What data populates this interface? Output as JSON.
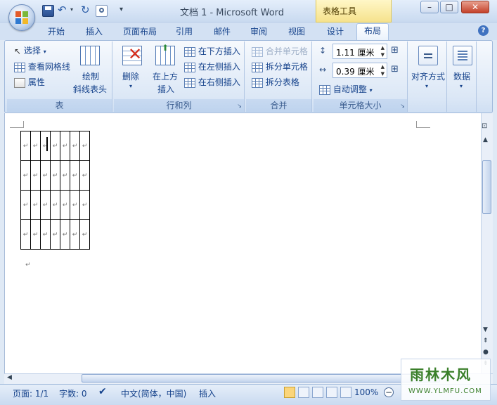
{
  "title": {
    "doc_title": "文档 1 - Microsoft Word",
    "context_tool": "表格工具"
  },
  "window_controls": {
    "minimize": "–",
    "maximize": "□",
    "close": "✕"
  },
  "tabs": [
    {
      "label": "开始"
    },
    {
      "label": "插入"
    },
    {
      "label": "页面布局"
    },
    {
      "label": "引用"
    },
    {
      "label": "邮件"
    },
    {
      "label": "审阅"
    },
    {
      "label": "视图"
    },
    {
      "label": "设计"
    },
    {
      "label": "布局"
    }
  ],
  "help_label": "?",
  "ribbon": {
    "table_group": {
      "label": "表",
      "select": "选择",
      "view_gridlines": "查看网格线",
      "properties": "属性",
      "draw_diagonal_1": "绘制",
      "draw_diagonal_2": "斜线表头"
    },
    "rows_cols_group": {
      "label": "行和列",
      "delete": "删除",
      "insert_above_1": "在上方",
      "insert_above_2": "插入",
      "insert_below": "在下方插入",
      "insert_left": "在左侧插入",
      "insert_right": "在右侧插入"
    },
    "merge_group": {
      "label": "合并",
      "merge_cells": "合并单元格",
      "split_cells": "拆分单元格",
      "split_table": "拆分表格"
    },
    "cell_size_group": {
      "label": "单元格大小",
      "height_value": "1.11 厘米",
      "width_value": "0.39 厘米",
      "autofit": "自动调整"
    },
    "alignment": {
      "label": "对齐方式"
    },
    "data": {
      "label": "数据"
    }
  },
  "document": {
    "table": {
      "rows": 4,
      "cols": 7,
      "cell_mark": "↵"
    },
    "after_mark": "↵"
  },
  "status_bar": {
    "page": "页面: 1/1",
    "words": "字数: 0",
    "language": "中文(简体，中国)",
    "mode": "插入",
    "zoom": "100%"
  },
  "watermark": {
    "brand": "雨林木风",
    "url": "WWW.YLMFU.COM"
  },
  "colors": {
    "ribbon_text": "#15428b",
    "context_tab": "#f6e28d",
    "title_text": "#3a4a5f"
  }
}
